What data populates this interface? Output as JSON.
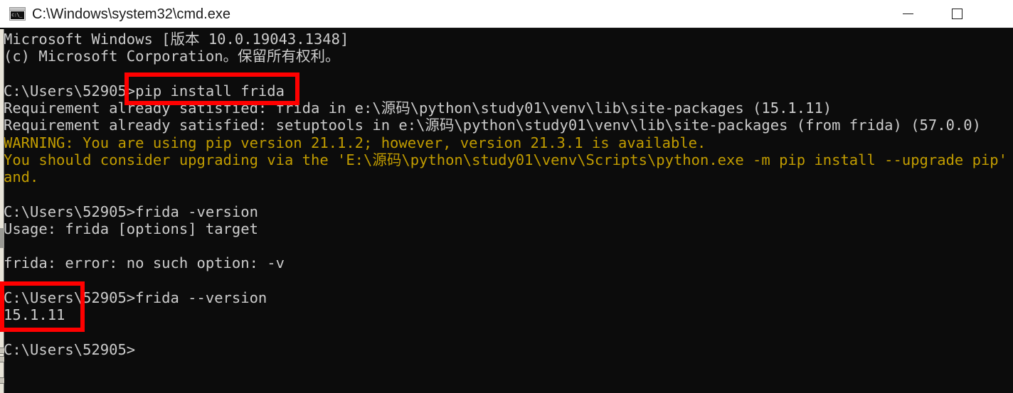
{
  "window": {
    "title": "C:\\Windows\\system32\\cmd.exe",
    "icon": "cmd-console-icon",
    "icon_text": "c:\\_",
    "controls": {
      "minimize": "minimize-button",
      "maximize": "maximize-button",
      "close": "close-button"
    },
    "colors": {
      "titlebar_background": "#ffffff",
      "titlebar_text": "#1b1b1b",
      "console_background": "#0c0c0c",
      "console_text": "#cccccc",
      "warning_text": "#c19c00",
      "annotation": "#ff0000",
      "scrollbar_track": "#e8e4d8",
      "scrollbar_thumb": "#9a9a94"
    }
  },
  "terminal": {
    "lines": [
      {
        "text": "Microsoft Windows [版本 10.0.19043.1348]",
        "style": "normal"
      },
      {
        "text": "(c) Microsoft Corporation。保留所有权利。",
        "style": "normal"
      },
      {
        "text": "",
        "style": "blank"
      },
      {
        "text": "C:\\Users\\52905>pip install frida",
        "style": "normal"
      },
      {
        "text": "Requirement already satisfied: frida in e:\\源码\\python\\study01\\venv\\lib\\site-packages (15.1.11)",
        "style": "normal"
      },
      {
        "text": "Requirement already satisfied: setuptools in e:\\源码\\python\\study01\\venv\\lib\\site-packages (from frida) (57.0.0)",
        "style": "normal"
      },
      {
        "text": "WARNING: You are using pip version 21.1.2; however, version 21.3.1 is available.",
        "style": "warn"
      },
      {
        "text": "You should consider upgrading via the 'E:\\源码\\python\\study01\\venv\\Scripts\\python.exe -m pip install --upgrade pip' co",
        "style": "warn"
      },
      {
        "text": "and.",
        "style": "warn"
      },
      {
        "text": "",
        "style": "blank"
      },
      {
        "text": "C:\\Users\\52905>frida -version",
        "style": "normal"
      },
      {
        "text": "Usage: frida [options] target",
        "style": "normal"
      },
      {
        "text": "",
        "style": "blank"
      },
      {
        "text": "frida: error: no such option: -v",
        "style": "normal"
      },
      {
        "text": "",
        "style": "blank"
      },
      {
        "text": "C:\\Users\\52905>frida --version",
        "style": "normal"
      },
      {
        "text": "15.1.11",
        "style": "normal"
      },
      {
        "text": "",
        "style": "blank"
      },
      {
        "text": "C:\\Users\\52905>",
        "style": "normal"
      }
    ],
    "prompt": "C:\\Users\\52905>",
    "commands": [
      "pip install frida",
      "frida -version",
      "frida --version"
    ],
    "frida_version": "15.1.11",
    "pip_version_current": "21.1.2",
    "pip_version_available": "21.3.1",
    "setuptools_version": "57.0.0",
    "site_packages_path": "e:\\源码\\python\\study01\\venv\\lib\\site-packages"
  },
  "annotations": [
    {
      "name": "pip-install-command-highlight",
      "target": "pip install frida"
    },
    {
      "name": "frida-version-output-highlight",
      "target": "15.1.11"
    }
  ]
}
